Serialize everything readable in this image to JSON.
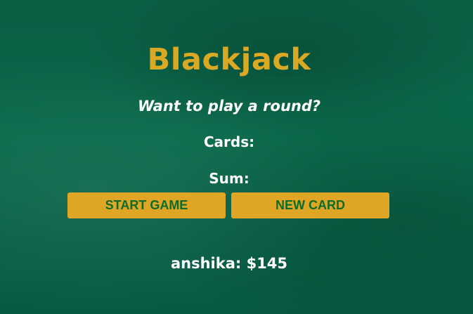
{
  "game": {
    "title": "Blackjack",
    "message": "Want to play a round?",
    "cards_label": "Cards:",
    "cards_value": "",
    "sum_label": "Sum:",
    "sum_value": ""
  },
  "buttons": {
    "start_label": "START GAME",
    "new_card_label": "NEW CARD"
  },
  "player": {
    "text": "anshika: $145"
  },
  "colors": {
    "table_green": "#0a6a4c",
    "gold": "#dea624",
    "button_text": "#0f6b2a",
    "text": "#ffffff"
  }
}
